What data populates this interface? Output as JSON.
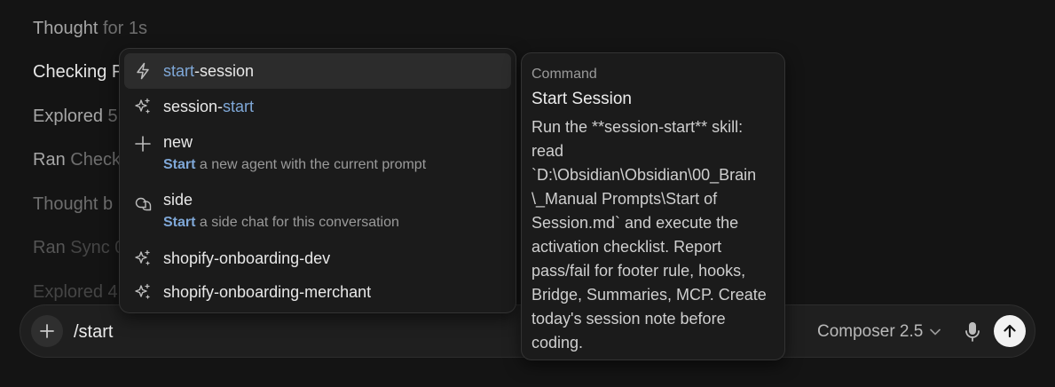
{
  "transcript": {
    "lines": [
      {
        "prefix": "Thought",
        "suffix": "for 1s"
      },
      {
        "prefix": "Checking F",
        "suffix": ""
      },
      {
        "prefix": "Explored",
        "suffix": "5"
      },
      {
        "prefix": "Ran",
        "suffix": "Check"
      },
      {
        "prefix": "Thought b",
        "suffix": ""
      },
      {
        "prefix": "Ran",
        "suffix": "Sync 0"
      },
      {
        "prefix": "Explored",
        "suffix": "4"
      }
    ]
  },
  "composer": {
    "input_value": "/start",
    "model_label": "Composer 2.5",
    "icons": {
      "add": "plus-icon",
      "model_dropdown": "chevron-down-icon",
      "mic": "microphone-icon",
      "send": "arrow-up-icon"
    }
  },
  "command_menu": {
    "items": [
      {
        "icon": "lightning-icon",
        "title_hl": "start",
        "title_rest": "-session",
        "selected": true
      },
      {
        "icon": "sparkle-icon",
        "title_pre": "session-",
        "title_hl": "start"
      },
      {
        "icon": "plus-icon",
        "title": "new",
        "desc_hl": "Start",
        "desc_rest": " a new agent with the current prompt"
      },
      {
        "icon": "side-chat-icon",
        "title": "side",
        "desc_hl": "Start",
        "desc_rest": " a side chat for this conversation"
      },
      {
        "icon": "sparkle-icon",
        "title": "shopify-onboarding-dev"
      },
      {
        "icon": "sparkle-icon",
        "title": "shopify-onboarding-merchant"
      }
    ]
  },
  "tooltip": {
    "kind": "Command",
    "title": "Start Session",
    "body_lines": [
      "Run the **session-start** skill:",
      "read",
      "`D:\\Obsidian\\Obsidian\\00_Brain",
      "\\_Manual Prompts\\Start of",
      "Session.md` and execute the",
      "activation checklist. Report",
      "pass/fail for footer rule, hooks,",
      "Bridge, Summaries, MCP. Create",
      "today's session note before",
      "coding."
    ]
  },
  "colors": {
    "background": "#141414",
    "panel": "#1b1b1b",
    "highlight": "#7fa8d8",
    "selected_row": "#2c2c2c"
  }
}
